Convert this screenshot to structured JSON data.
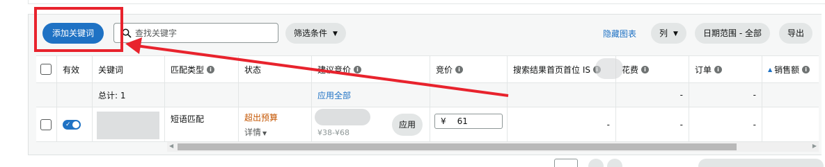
{
  "toolbar": {
    "add_keyword": "添加关键词",
    "search_placeholder": "查找关键字",
    "filter": "筛选条件",
    "hide_chart": "隐藏图表",
    "columns": "列",
    "date_range": "日期范围 - 全部",
    "export": "导出"
  },
  "table": {
    "headers": {
      "enabled": "有效",
      "keyword": "关键词",
      "match_type": "匹配类型",
      "status": "状态",
      "suggested_bid": "建议竞价",
      "bid": "竞价",
      "top_of_search_is": "搜索结果首页首位 IS",
      "spend": "花费",
      "orders": "订单",
      "sales": "销售额"
    },
    "sort_indicator": "▲",
    "total_row": {
      "label": "总计: 1",
      "apply_all": "应用全部",
      "spend": "-",
      "orders": "-"
    },
    "rows": [
      {
        "match_type": "短语匹配",
        "status": "超出预算",
        "status_detail": "详情",
        "suggested_range": "¥38-¥68",
        "apply": "应用",
        "currency": "¥",
        "bid_value": "61",
        "top_of_search_is": "-",
        "spend": "-",
        "orders": "-"
      }
    ]
  },
  "colors": {
    "accent": "#1f72c4",
    "warning": "#c45500",
    "annotation": "#e8232d"
  },
  "icons": [
    "search-icon",
    "chevron-down-icon",
    "info-icon",
    "toggle-check-icon",
    "caret-down-icon",
    "arrow-left-icon",
    "arrow-right-icon"
  ]
}
